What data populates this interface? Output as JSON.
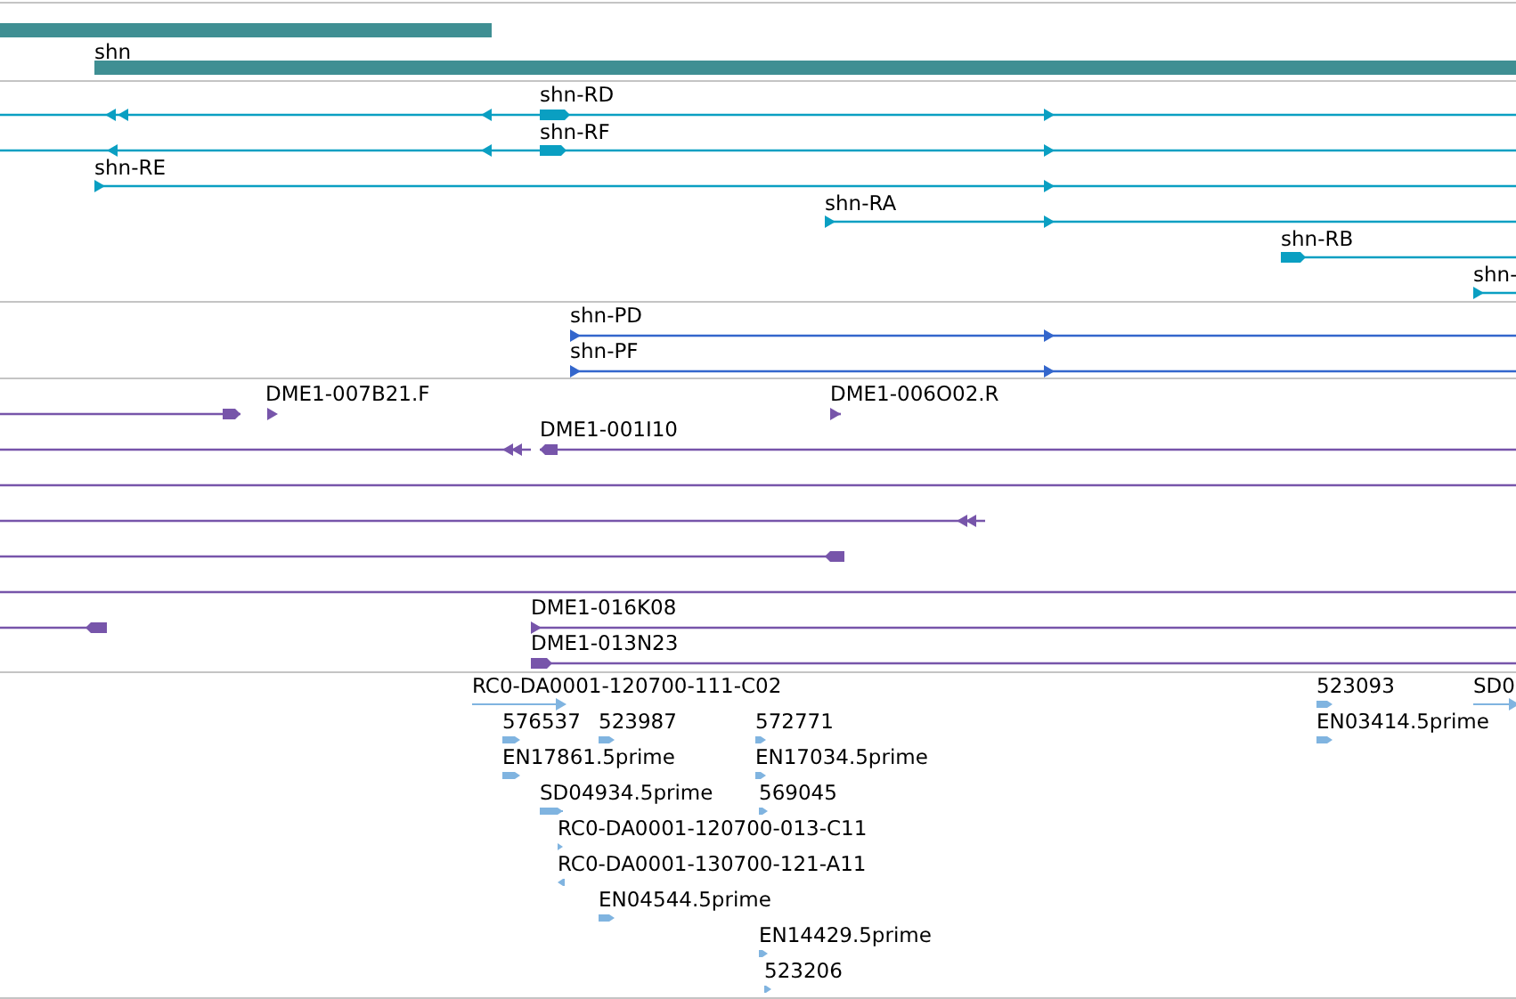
{
  "tracks": [
    {
      "color": "#3f8f93",
      "features": [
        {
          "kind": "gene"
        },
        {
          "kind": "gene",
          "label": "shn"
        }
      ]
    },
    {
      "color": "#0a9fc2",
      "features": [
        {
          "kind": "transcript",
          "label": "shn-RD"
        },
        {
          "kind": "transcript",
          "label": "shn-RF"
        },
        {
          "kind": "transcript",
          "label": "shn-RE"
        },
        {
          "kind": "transcript",
          "label": "shn-RA"
        },
        {
          "kind": "transcript",
          "label": "shn-RB"
        },
        {
          "kind": "transcript",
          "label": "shn-"
        }
      ]
    },
    {
      "color": "#3366cc",
      "features": [
        {
          "kind": "protein",
          "label": "shn-PD"
        },
        {
          "kind": "protein",
          "label": "shn-PF"
        }
      ]
    },
    {
      "color": "#7755aa",
      "features": [
        {
          "kind": "clone"
        },
        {
          "kind": "clone",
          "label": "DME1-007B21.F"
        },
        {
          "kind": "clone",
          "label": "DME1-006O02.R"
        },
        {
          "kind": "clone"
        },
        {
          "kind": "clone",
          "label": "DME1-001I10"
        },
        {
          "kind": "clone"
        },
        {
          "kind": "clone"
        },
        {
          "kind": "clone"
        },
        {
          "kind": "clone"
        },
        {
          "kind": "clone"
        },
        {
          "kind": "clone",
          "label": "DME1-016K08"
        },
        {
          "kind": "clone",
          "label": "DME1-013N23"
        }
      ]
    },
    {
      "color": "#80b4e0",
      "features": [
        {
          "kind": "est",
          "label": "RC0-DA0001-120700-111-C02"
        },
        {
          "kind": "est",
          "label": "523093"
        },
        {
          "kind": "est",
          "label": "SD0"
        },
        {
          "kind": "est",
          "label": "576537"
        },
        {
          "kind": "est",
          "label": "523987"
        },
        {
          "kind": "est",
          "label": "572771"
        },
        {
          "kind": "est",
          "label": "EN03414.5prime"
        },
        {
          "kind": "est",
          "label": "EN17861.5prime"
        },
        {
          "kind": "est",
          "label": "EN17034.5prime"
        },
        {
          "kind": "est",
          "label": "SD04934.5prime"
        },
        {
          "kind": "est",
          "label": "569045"
        },
        {
          "kind": "est",
          "label": "RC0-DA0001-120700-013-C11"
        },
        {
          "kind": "est",
          "label": "RC0-DA0001-130700-121-A11"
        },
        {
          "kind": "est",
          "label": "EN04544.5prime"
        },
        {
          "kind": "est",
          "label": "EN14429.5prime"
        },
        {
          "kind": "est",
          "label": "523206"
        }
      ]
    }
  ]
}
